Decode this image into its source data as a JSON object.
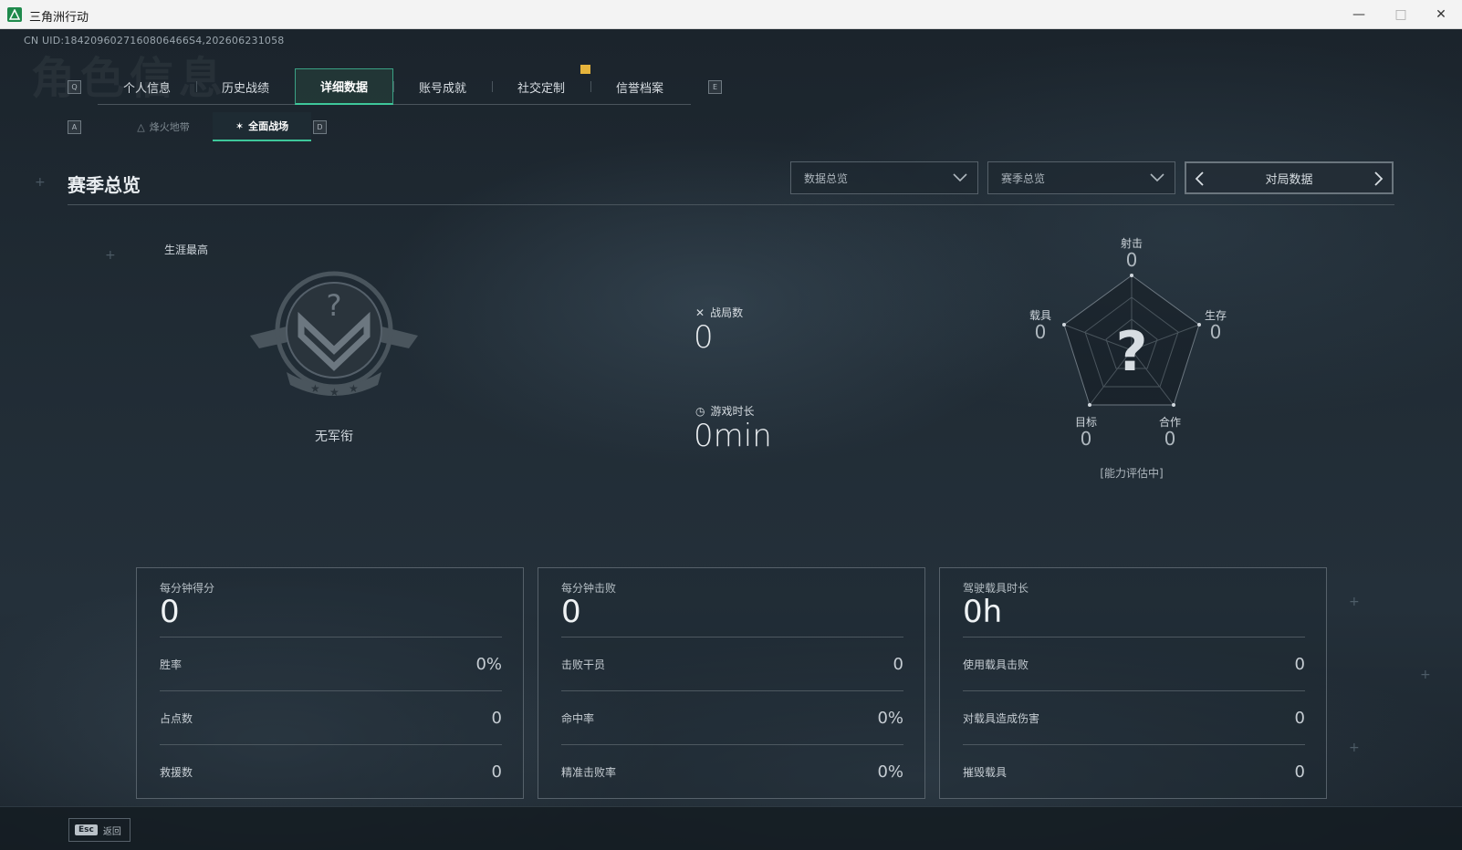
{
  "window": {
    "title": "三角洲行动"
  },
  "uid": "CN UID:1842096027160806466S4,202606231058",
  "watermark": "角色信息",
  "tabs": {
    "prev_key": "Q",
    "next_key": "E",
    "items": [
      {
        "label": "个人信息"
      },
      {
        "label": "历史战绩"
      },
      {
        "label": "详细数据",
        "active": true
      },
      {
        "label": "账号成就"
      },
      {
        "label": "社交定制"
      },
      {
        "label": "信誉档案"
      }
    ]
  },
  "subtabs": {
    "prev_key": "A",
    "next_key": "D",
    "items": [
      {
        "label": "烽火地带",
        "icon": "flame-zone-icon"
      },
      {
        "label": "全面战场",
        "icon": "battlefield-icon",
        "active": true
      }
    ]
  },
  "section": {
    "title": "赛季总览",
    "dropdown1": "数据总览",
    "dropdown2": "赛季总览",
    "pager": "对局数据"
  },
  "career": {
    "label": "生涯最高",
    "rank_name": "无军衔"
  },
  "middle": {
    "matches_label": "战局数",
    "matches_value": "0",
    "playtime_label": "游戏时长",
    "playtime_value": "0min"
  },
  "radar": {
    "shoot_label": "射击",
    "shoot_value": "0",
    "survive_label": "生存",
    "survive_value": "0",
    "coop_label": "合作",
    "coop_value": "0",
    "target_label": "目标",
    "target_value": "0",
    "vehicle_label": "载具",
    "vehicle_value": "0",
    "center": "?",
    "status": "[能力评估中]"
  },
  "cards": [
    {
      "head_label": "每分钟得分",
      "head_value": "0",
      "rows": [
        {
          "label": "胜率",
          "value": "0%"
        },
        {
          "label": "占点数",
          "value": "0"
        },
        {
          "label": "救援数",
          "value": "0"
        }
      ]
    },
    {
      "head_label": "每分钟击败",
      "head_value": "0",
      "rows": [
        {
          "label": "击败干员",
          "value": "0"
        },
        {
          "label": "命中率",
          "value": "0%"
        },
        {
          "label": "精准击败率",
          "value": "0%"
        }
      ]
    },
    {
      "head_label": "驾驶载具时长",
      "head_value": "0h",
      "rows": [
        {
          "label": "使用载具击败",
          "value": "0"
        },
        {
          "label": "对载具造成伤害",
          "value": "0"
        },
        {
          "label": "摧毁载具",
          "value": "0"
        }
      ]
    }
  ],
  "bottom": {
    "esc_key": "Esc",
    "back_label": "返回"
  }
}
